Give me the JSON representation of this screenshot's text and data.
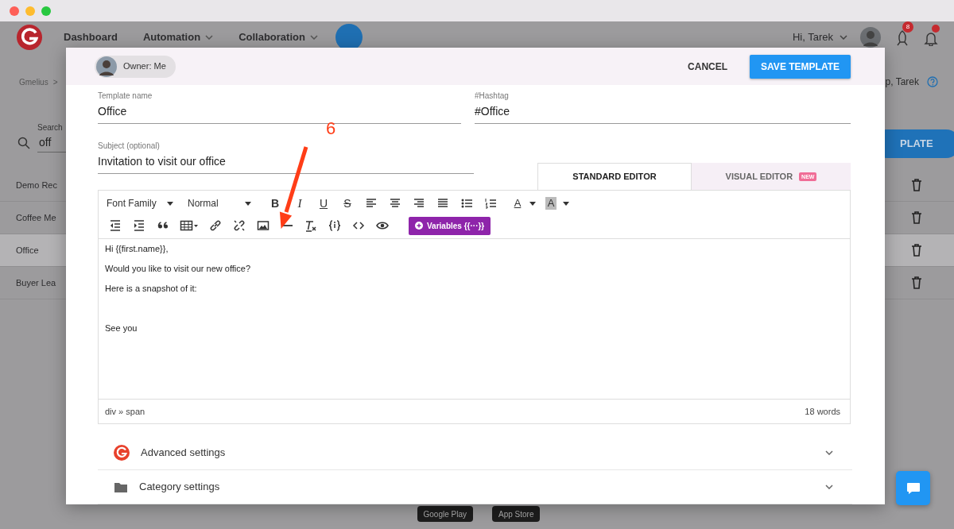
{
  "app_header": {
    "nav": [
      {
        "label": "Dashboard",
        "dropdown": false
      },
      {
        "label": "Automation",
        "dropdown": true
      },
      {
        "label": "Collaboration",
        "dropdown": true
      }
    ],
    "greeting": "Hi, Tarek",
    "notification_count": "8",
    "alert_dot": true
  },
  "breadcrumb": {
    "root": "Gmelius",
    "separator": ">",
    "user": "p, Tarek"
  },
  "search": {
    "label": "Search",
    "value": "off"
  },
  "new_template_button": "PLATE",
  "template_list": [
    {
      "name": "Demo Rec",
      "selected": false
    },
    {
      "name": "Coffee Me",
      "selected": false
    },
    {
      "name": "Office",
      "selected": true
    },
    {
      "name": "Buyer Lea",
      "selected": false
    }
  ],
  "store_badges": [
    "Google Play",
    "App Store"
  ],
  "modal": {
    "owner": "Owner: Me",
    "cancel": "CANCEL",
    "save": "SAVE TEMPLATE",
    "fields": [
      {
        "label": "Template name",
        "value": "Office"
      },
      {
        "label": "#Hashtag",
        "value": "#Office"
      },
      {
        "label": "Subject (optional)",
        "value": "Invitation to visit our office"
      }
    ],
    "editor_tabs": [
      {
        "label": "STANDARD EDITOR",
        "selected": true
      },
      {
        "label": "VISUAL EDITOR",
        "selected": false,
        "badge": "NEW"
      }
    ],
    "toolbar": {
      "font_family": "Font Family",
      "font_size": "Normal",
      "glyphs": [
        "B",
        "I",
        "U",
        "S",
        "A",
        "A"
      ],
      "variables": "Variables {{···}}"
    },
    "body": [
      {
        "kind": "text",
        "text": "Hi {{first.name}},"
      },
      {
        "kind": "text",
        "text": "Would you like to visit our new office?"
      },
      {
        "kind": "text",
        "text": "Here is a snapshot of it:"
      },
      {
        "kind": "blank"
      },
      {
        "kind": "text",
        "text": "See you"
      }
    ],
    "status_path": "div » span",
    "word_count": "18 words",
    "sections": [
      {
        "kind": "brand",
        "label": "Advanced settings",
        "expanded": false
      },
      {
        "kind": "folder",
        "label": "Category settings",
        "expanded": false
      }
    ]
  },
  "annotation": {
    "number": "6"
  }
}
